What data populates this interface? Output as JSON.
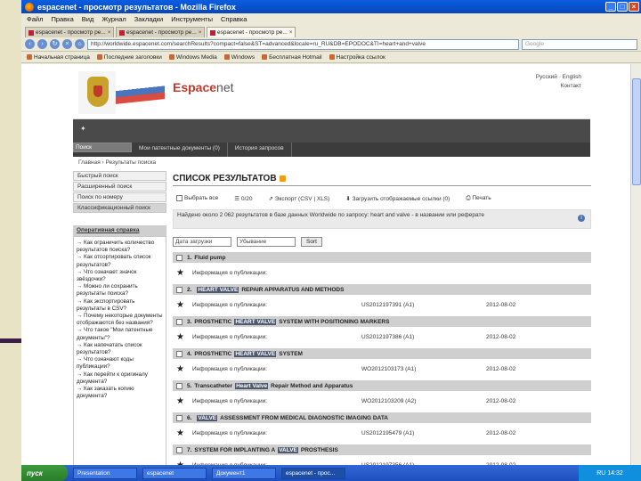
{
  "window": {
    "title": "espacenet - просмотр результатов - Mozilla Firefox",
    "buttons": [
      "_",
      "□",
      "×"
    ]
  },
  "menu": [
    "Файл",
    "Правка",
    "Вид",
    "Журнал",
    "Закладки",
    "Инструменты",
    "Справка"
  ],
  "tabs": [
    "espacenet - просмотр ре...",
    "espacenet - просмотр ре...",
    "espacenet - просмотр ре..."
  ],
  "address": {
    "url": "http://worldwide.espacenet.com/searchResults?compact=false&ST=advanced&locale=ru_RU&DB=EPODOC&TI=heart+and+valve",
    "search_placeholder": "Google"
  },
  "bookmarks": [
    "Начальная страница",
    "Последние заголовки",
    "Windows Media",
    "Windows",
    "Бесплатная Hotmail",
    "Настройка ссылок"
  ],
  "header": {
    "logo_a": "Espace",
    "logo_b": "net",
    "lang1": "Русский · English",
    "lang2": "Контакт"
  },
  "nav": {
    "tabs": [
      "Поиск",
      "Мои патентные документы (0)",
      "История запросов"
    ],
    "crumb": "Главная › Результаты поиска"
  },
  "left_menu": [
    "Быстрый поиск",
    "Расширенный поиск",
    "Поиск по номеру",
    "Классификационный поиск"
  ],
  "help": {
    "title": "Оперативная справка",
    "items": [
      "Как ограничить количество результатов поиска?",
      "Как отсортировать список результатов?",
      "Что означает значок звёздочки?",
      "Можно ли сохранить результаты поиска?",
      "Как экспортировать результаты в CSV?",
      "Почему некоторые документы отображаются без названия?",
      "Что такое \"Мои патентные документы\"?",
      "Как напечатать список результатов?",
      "Что означают коды публикации?",
      "Как перейти к оригиналу документа?",
      "Как заказать копию документа?"
    ]
  },
  "results": {
    "heading": "СПИСОК РЕЗУЛЬТАТОВ",
    "actions": [
      "Выбрать все",
      "0/20",
      "Экспорт (CSV | XLS)",
      "Загрузить отображаемые ссылки (0)",
      "Печать"
    ],
    "summary": "Найдено около 2 062 результатов в базе данных Worldwide по запросу: heart and valve - в названии или реферате",
    "sort_field": "Дата загрузки",
    "sort_order": "Убывание",
    "sort_button": "Sort",
    "info_label": "Информация о публикации:",
    "items": [
      {
        "num": "1.",
        "pre": "Fluid pump",
        "hl": "",
        "post": "",
        "pub": "",
        "date": ""
      },
      {
        "num": "2.",
        "pre": "",
        "hl": "HEART VALVE",
        "post": " REPAIR APPARATUS AND METHODS",
        "pub": "US2012197391 (A1)",
        "date": "2012-08-02"
      },
      {
        "num": "3.",
        "pre": "PROSTHETIC ",
        "hl": "HEART VALVE",
        "post": " SYSTEM WITH POSITIONING MARKERS",
        "pub": "US2012197386 (A1)",
        "date": "2012-08-02"
      },
      {
        "num": "4.",
        "pre": "PROSTHETIC ",
        "hl": "HEART VALVE",
        "post": " SYSTEM",
        "pub": "WO2012103173 (A1)",
        "date": "2012-08-02"
      },
      {
        "num": "5.",
        "pre": "Transcatheter ",
        "hl": "Heart Valve",
        "post": " Repair Method and Apparatus",
        "pub": "WO2012103209 (A2)",
        "date": "2012-08-02"
      },
      {
        "num": "6.",
        "pre": "",
        "hl": "VALVE",
        "post": " ASSESSMENT FROM MEDICAL DIAGNOSTIC IMAGING DATA",
        "pub": "US2012195479 (A1)",
        "date": "2012-08-02"
      },
      {
        "num": "7.",
        "pre": "SYSTEM FOR IMPLANTING A ",
        "hl": "VALVE",
        "post": " PROSTHESIS",
        "pub": "US2012197356 (A1)",
        "date": "2012-08-02"
      }
    ]
  },
  "taskbar": {
    "start": "пуск",
    "items": [
      "Presentation",
      "espacenet",
      "Документ1",
      "espacenet - прос..."
    ],
    "tray": "RU 14:32"
  }
}
